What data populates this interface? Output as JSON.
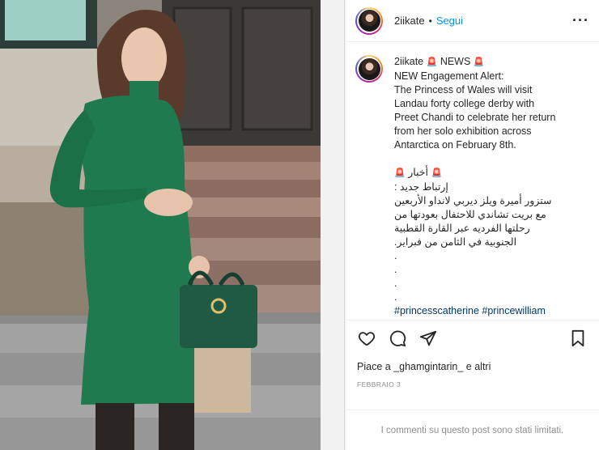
{
  "post": {
    "username": "2iikate",
    "follow_label": "Segui",
    "dot": "•",
    "more_icon": "···"
  },
  "caption": {
    "username": "2iikate",
    "title_line": "NEWS",
    "siren_emoji": "🚨",
    "english": [
      "NEW Engagement Alert:",
      "The Princess of Wales will visit Landau forty college derby with Preet Chandi to celebrate her return from her solo exhibition across Antarctica on February 8th."
    ],
    "arabic_title": "أخبار",
    "arabic_subtitle": "إرتباط جديد :",
    "arabic_body": "ستزور أميرة ويلز ديربي لانداو الأربعين مع بريت تشاندي للاحتفال بعودتها من رحلتها الفرديه عبر القارة القطبية الجنوبية في الثامن من فبراير.",
    "dots": [
      ".",
      ".",
      ".",
      "."
    ],
    "hashtags": [
      "#princesscatherine",
      "#princewilliam"
    ]
  },
  "actions": {
    "like_icon": "heart-icon",
    "comment_icon": "comment-icon",
    "share_icon": "share-icon",
    "save_icon": "bookmark-icon"
  },
  "likes_text": "Piace a _ghamgintarin_ e altri",
  "date_text": "FEBBRAIO 3",
  "comments_limited": "I commenti su questo post sono stati limitati.",
  "colors": {
    "accent_blue": "#0095f6",
    "hashtag": "#00376b",
    "dress_green": "#1f7a4f",
    "muted": "#8e8e8e"
  }
}
